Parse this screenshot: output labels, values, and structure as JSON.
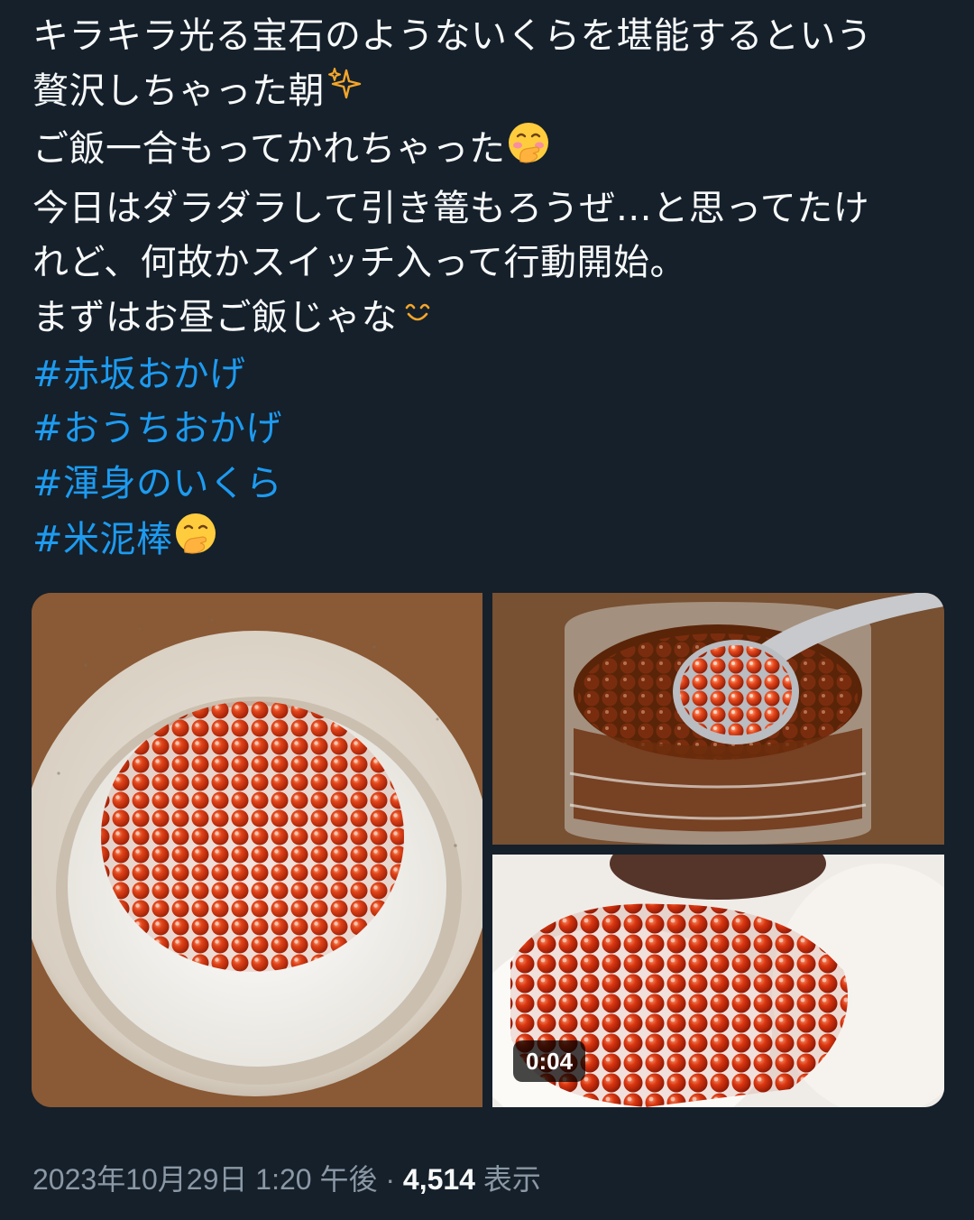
{
  "tweet": {
    "lines": [
      "キラキラ光る宝石のようないくらを堪能するという",
      "贅沢しちゃった朝",
      "ご飯一合もってかれちゃった",
      "今日はダラダラして引き篭もろうぜ…と思ってたけ",
      "れど、何故かスイッチ入って行動開始。",
      "まずはお昼ご飯じゃな"
    ],
    "emojis": [
      "sparkles-icon",
      "hand-over-mouth-icon",
      "smiling-face-icon"
    ],
    "hashtags": [
      "#赤坂おかげ",
      "#おうちおかげ",
      "#渾身のいくら",
      "#米泥棒"
    ],
    "last_hashtag_emoji": "hand-over-mouth-icon"
  },
  "media": {
    "video_duration": "0:04"
  },
  "meta": {
    "timestamp": "2023年10月29日 1:20 午後",
    "separator": "·",
    "views_count": "4,514",
    "views_label": "表示"
  },
  "colors": {
    "background": "#15202b",
    "text": "#f7f9f9",
    "link": "#1d9bf0",
    "muted": "#8b98a5"
  }
}
